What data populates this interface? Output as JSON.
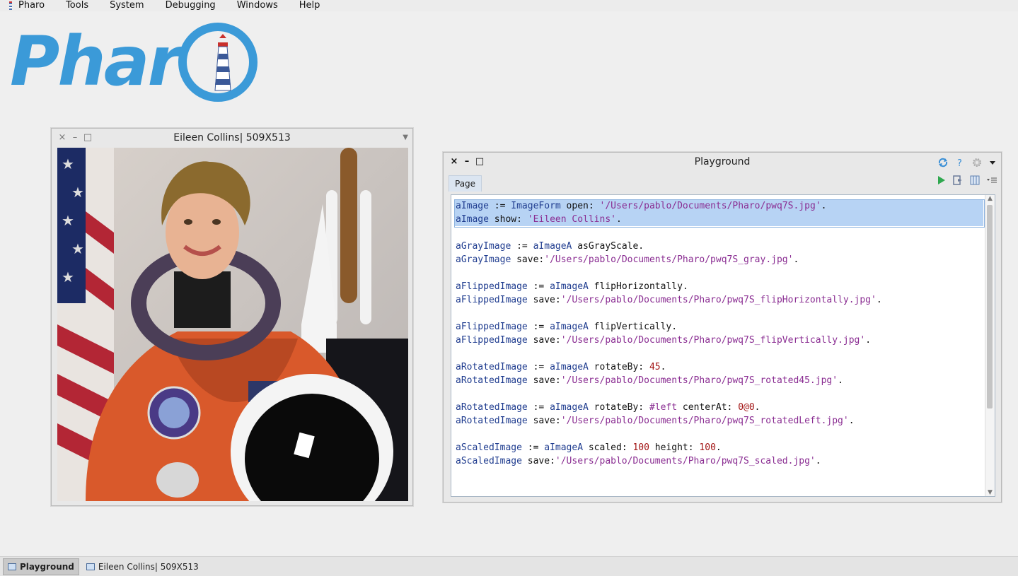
{
  "menubar": {
    "items": [
      "Pharo",
      "Tools",
      "System",
      "Debugging",
      "Windows",
      "Help"
    ]
  },
  "logo": {
    "brand_text": "Phar",
    "brand_color": "#3b9ad8"
  },
  "image_window": {
    "title": "Eileen Collins| 509X513",
    "controls": {
      "close": "×",
      "minimize": "–",
      "maximize": "□"
    },
    "menu_arrow": "▼"
  },
  "playground": {
    "title": "Playground",
    "tab_label": "Page",
    "controls": {
      "close": "×",
      "minimize": "–",
      "maximize": "□"
    },
    "title_icons": [
      "sync-icon",
      "help-icon",
      "settings-icon",
      "dropdown-arrow-icon"
    ],
    "toolbar_icons": [
      "run-icon",
      "bind-icon",
      "layout-icon",
      "menu-icon"
    ],
    "code_lines": [
      {
        "selected": true,
        "parts": [
          [
            "v",
            "aImage"
          ],
          [
            "m",
            " := "
          ],
          [
            "k",
            "ImageForm"
          ],
          [
            "m",
            " open: "
          ],
          [
            "s",
            "'/Users/pablo/Documents/Pharo/pwq7S.jpg'"
          ],
          [
            "m",
            "."
          ]
        ]
      },
      {
        "selected": true,
        "parts": [
          [
            "v",
            "aImage"
          ],
          [
            "m",
            " show: "
          ],
          [
            "s",
            "'Eileen Collins'"
          ],
          [
            "m",
            "."
          ]
        ]
      },
      {
        "selected": false,
        "parts": [
          [
            "m",
            ""
          ]
        ]
      },
      {
        "selected": false,
        "parts": [
          [
            "v",
            "aGrayImage"
          ],
          [
            "m",
            " := "
          ],
          [
            "v",
            "aImageA"
          ],
          [
            "m",
            " asGrayScale."
          ]
        ]
      },
      {
        "selected": false,
        "parts": [
          [
            "v",
            "aGrayImage"
          ],
          [
            "m",
            " save:"
          ],
          [
            "s",
            "'/Users/pablo/Documents/Pharo/pwq7S_gray.jpg'"
          ],
          [
            "m",
            "."
          ]
        ]
      },
      {
        "selected": false,
        "parts": [
          [
            "m",
            ""
          ]
        ]
      },
      {
        "selected": false,
        "parts": [
          [
            "v",
            "aFlippedImage"
          ],
          [
            "m",
            " := "
          ],
          [
            "v",
            "aImageA"
          ],
          [
            "m",
            " flipHorizontally."
          ]
        ]
      },
      {
        "selected": false,
        "parts": [
          [
            "v",
            "aFlippedImage"
          ],
          [
            "m",
            " save:"
          ],
          [
            "s",
            "'/Users/pablo/Documents/Pharo/pwq7S_flipHorizontally.jpg'"
          ],
          [
            "m",
            "."
          ]
        ]
      },
      {
        "selected": false,
        "parts": [
          [
            "m",
            ""
          ]
        ]
      },
      {
        "selected": false,
        "parts": [
          [
            "v",
            "aFlippedImage"
          ],
          [
            "m",
            " := "
          ],
          [
            "v",
            "aImageA"
          ],
          [
            "m",
            " flipVertically."
          ]
        ]
      },
      {
        "selected": false,
        "parts": [
          [
            "v",
            "aFlippedImage"
          ],
          [
            "m",
            " save:"
          ],
          [
            "s",
            "'/Users/pablo/Documents/Pharo/pwq7S_flipVertically.jpg'"
          ],
          [
            "m",
            "."
          ]
        ]
      },
      {
        "selected": false,
        "parts": [
          [
            "m",
            ""
          ]
        ]
      },
      {
        "selected": false,
        "parts": [
          [
            "v",
            "aRotatedImage"
          ],
          [
            "m",
            " := "
          ],
          [
            "v",
            "aImageA"
          ],
          [
            "m",
            " rotateBy: "
          ],
          [
            "n",
            "45"
          ],
          [
            "m",
            "."
          ]
        ]
      },
      {
        "selected": false,
        "parts": [
          [
            "v",
            "aRotatedImage"
          ],
          [
            "m",
            " save:"
          ],
          [
            "s",
            "'/Users/pablo/Documents/Pharo/pwq7S_rotated45.jpg'"
          ],
          [
            "m",
            "."
          ]
        ]
      },
      {
        "selected": false,
        "parts": [
          [
            "m",
            ""
          ]
        ]
      },
      {
        "selected": false,
        "parts": [
          [
            "v",
            "aRotatedImage"
          ],
          [
            "m",
            " := "
          ],
          [
            "v",
            "aImageA"
          ],
          [
            "m",
            " rotateBy: "
          ],
          [
            "sy",
            "#left"
          ],
          [
            "m",
            " centerAt: "
          ],
          [
            "n",
            "0@0"
          ],
          [
            "m",
            "."
          ]
        ]
      },
      {
        "selected": false,
        "parts": [
          [
            "v",
            "aRotatedImage"
          ],
          [
            "m",
            " save:"
          ],
          [
            "s",
            "'/Users/pablo/Documents/Pharo/pwq7S_rotatedLeft.jpg'"
          ],
          [
            "m",
            "."
          ]
        ]
      },
      {
        "selected": false,
        "parts": [
          [
            "m",
            ""
          ]
        ]
      },
      {
        "selected": false,
        "parts": [
          [
            "v",
            "aScaledImage"
          ],
          [
            "m",
            " := "
          ],
          [
            "v",
            "aImageA"
          ],
          [
            "m",
            " scaled: "
          ],
          [
            "n",
            "100"
          ],
          [
            "m",
            " height: "
          ],
          [
            "n",
            "100"
          ],
          [
            "m",
            "."
          ]
        ]
      },
      {
        "selected": false,
        "parts": [
          [
            "v",
            "aScaledImage"
          ],
          [
            "m",
            " save:"
          ],
          [
            "s",
            "'/Users/pablo/Documents/Pharo/pwq7S_scaled.jpg'"
          ],
          [
            "m",
            "."
          ]
        ]
      }
    ]
  },
  "taskbar": {
    "items": [
      {
        "label": "Playground",
        "active": true
      },
      {
        "label": "Eileen Collins| 509X513",
        "active": false
      }
    ]
  }
}
